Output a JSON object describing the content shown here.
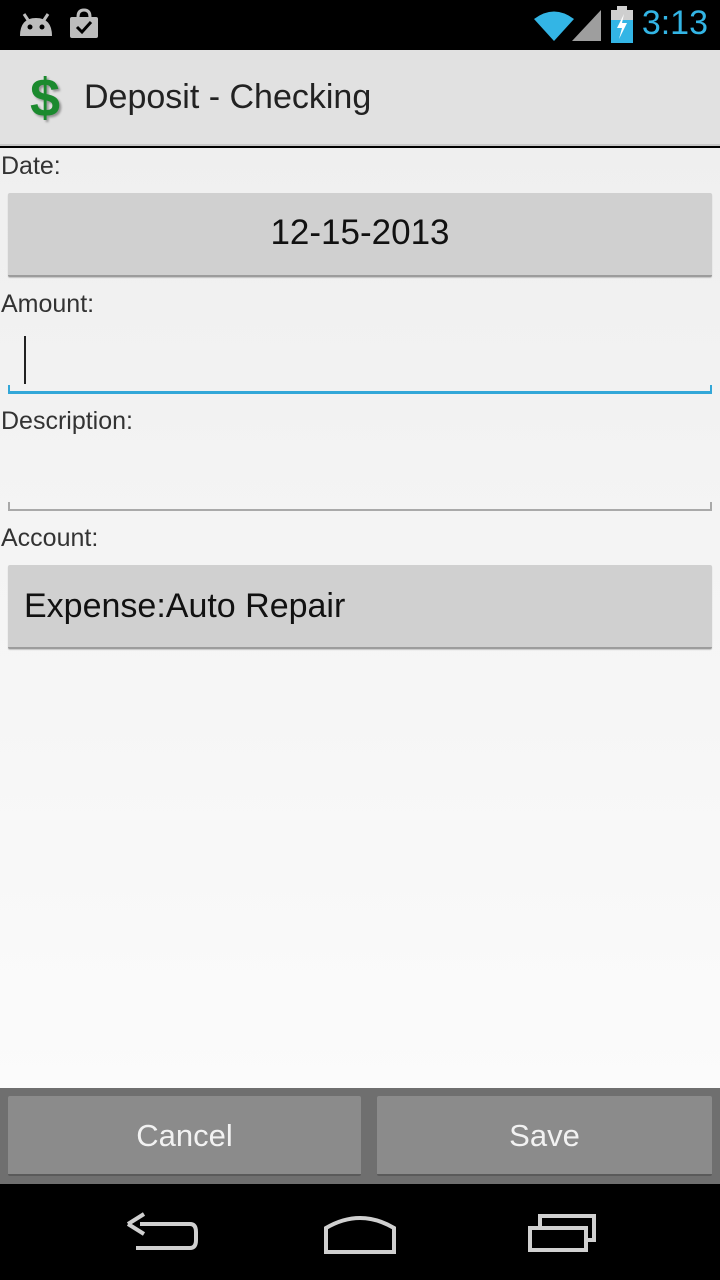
{
  "status_bar": {
    "time": "3:13",
    "icons": [
      "android-debug-icon",
      "shopping-bag-check-icon",
      "wifi-icon",
      "signal-icon",
      "battery-charging-icon"
    ],
    "time_color": "#33b5e5"
  },
  "action_bar": {
    "icon": "dollar-icon",
    "icon_glyph": "$",
    "title": "Deposit - Checking"
  },
  "form": {
    "date_label": "Date:",
    "date_value": "12-15-2013",
    "amount_label": "Amount:",
    "amount_value": "",
    "description_label": "Description:",
    "description_value": "",
    "account_label": "Account:",
    "account_value": "Expense:Auto Repair",
    "focus_color": "#33a7d8"
  },
  "buttons": {
    "cancel": "Cancel",
    "save": "Save"
  },
  "nav_bar": {
    "icons": [
      "back-icon",
      "home-icon",
      "recent-apps-icon"
    ]
  }
}
